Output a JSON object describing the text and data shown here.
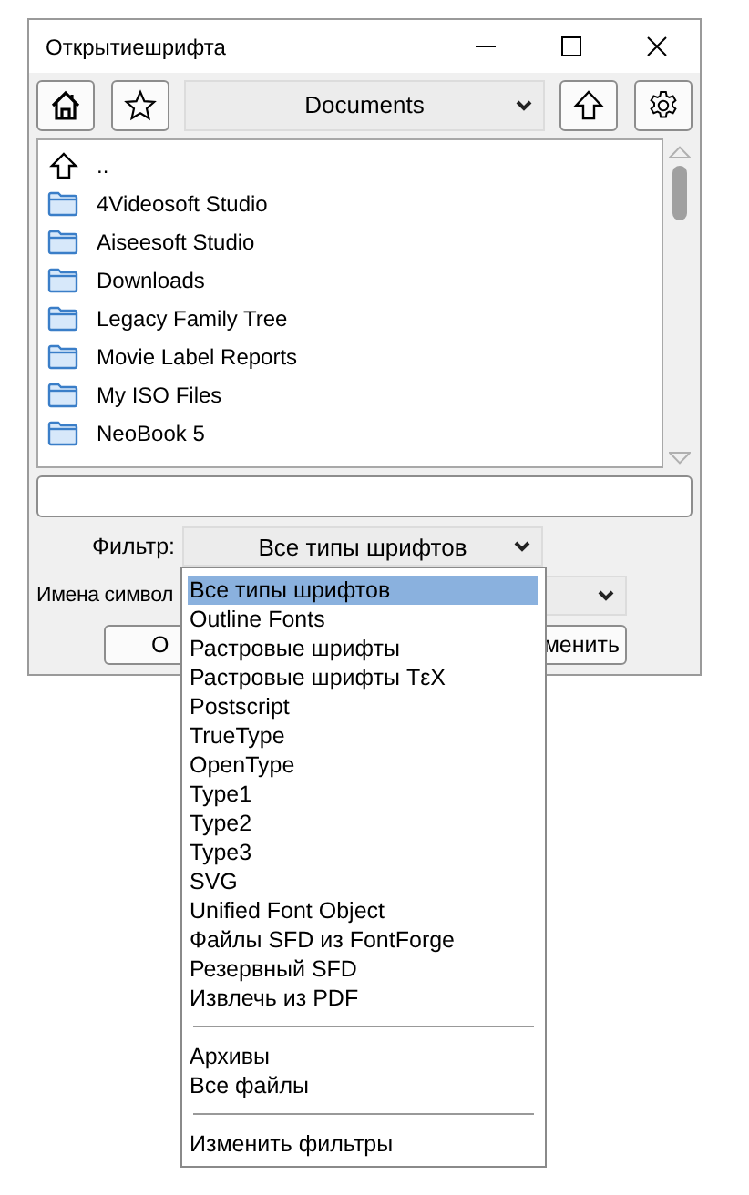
{
  "window": {
    "title": "Открытиешрифта"
  },
  "toolbar": {
    "location": "Documents"
  },
  "files": [
    {
      "name": "..",
      "kind": "parent"
    },
    {
      "name": "4Videosoft Studio",
      "kind": "folder"
    },
    {
      "name": "Aiseesoft Studio",
      "kind": "folder"
    },
    {
      "name": "Downloads",
      "kind": "folder"
    },
    {
      "name": "Legacy Family Tree",
      "kind": "folder"
    },
    {
      "name": "Movie Label Reports",
      "kind": "folder"
    },
    {
      "name": "My ISO Files",
      "kind": "folder"
    },
    {
      "name": "NeoBook 5",
      "kind": "folder"
    }
  ],
  "filter": {
    "label": "Фильтр:",
    "value": "Все типы шрифтов",
    "expanded": true,
    "options": [
      {
        "kind": "option",
        "label": "Все типы шрифтов",
        "selected": true
      },
      {
        "kind": "option",
        "label": "Outline Fonts",
        "selected": false
      },
      {
        "kind": "option",
        "label": "Растровые шрифты",
        "selected": false
      },
      {
        "kind": "option",
        "label": "Растровые шрифты TεX",
        "selected": false
      },
      {
        "kind": "option",
        "label": "Postscript",
        "selected": false
      },
      {
        "kind": "option",
        "label": "TrueType",
        "selected": false
      },
      {
        "kind": "option",
        "label": "OpenType",
        "selected": false
      },
      {
        "kind": "option",
        "label": "Type1",
        "selected": false
      },
      {
        "kind": "option",
        "label": "Type2",
        "selected": false
      },
      {
        "kind": "option",
        "label": "Type3",
        "selected": false
      },
      {
        "kind": "option",
        "label": "SVG",
        "selected": false
      },
      {
        "kind": "option",
        "label": "Unified Font Object",
        "selected": false
      },
      {
        "kind": "option",
        "label": "Файлы SFD из FontForge",
        "selected": false
      },
      {
        "kind": "option",
        "label": "Резервный SFD",
        "selected": false
      },
      {
        "kind": "option",
        "label": "Извлечь из PDF",
        "selected": false
      },
      {
        "kind": "separator"
      },
      {
        "kind": "option",
        "label": "Архивы",
        "selected": false
      },
      {
        "kind": "option",
        "label": "Все файлы",
        "selected": false
      },
      {
        "kind": "separator"
      },
      {
        "kind": "option",
        "label": "Изменить фильтры",
        "selected": false
      }
    ]
  },
  "symbol_names": {
    "label": "Имена символ"
  },
  "buttons": [
    "O",
    "менить"
  ]
}
